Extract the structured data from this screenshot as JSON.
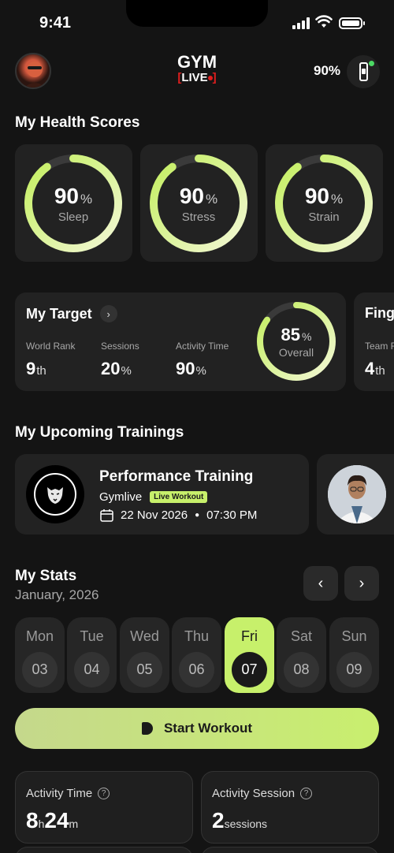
{
  "status_bar": {
    "time": "9:41"
  },
  "header": {
    "logo_line1": "GYM",
    "logo_line2": "LIVE",
    "device_battery": "90%"
  },
  "health": {
    "title": "My Health Scores",
    "scores": [
      {
        "label": "Sleep",
        "value": "90",
        "unit": "%",
        "progress": 0.9
      },
      {
        "label": "Stress",
        "value": "90",
        "unit": "%",
        "progress": 0.9
      },
      {
        "label": "Strain",
        "value": "90",
        "unit": "%",
        "progress": 0.9
      }
    ]
  },
  "target": {
    "title": "My Target",
    "stats": [
      {
        "label": "World Rank",
        "value": "9",
        "suffix": "th"
      },
      {
        "label": "Sessions",
        "value": "20",
        "suffix": "%"
      },
      {
        "label": "Activity Time",
        "value": "90",
        "suffix": "%"
      }
    ],
    "overall": {
      "value": "85",
      "unit": "%",
      "label": "Overall",
      "progress": 0.85
    },
    "next_card": {
      "title": "Fing",
      "label": "Team R",
      "value": "4",
      "suffix": "th"
    }
  },
  "trainings": {
    "title": "My Upcoming Trainings",
    "items": [
      {
        "title": "Performance Training",
        "org": "Gymlive",
        "badge": "Live Workout",
        "date": "22 Nov 2026",
        "time": "07:30 PM"
      }
    ]
  },
  "stats": {
    "title": "My Stats",
    "period": "January, 2026",
    "days": [
      {
        "name": "Mon",
        "num": "03",
        "active": false
      },
      {
        "name": "Tue",
        "num": "04",
        "active": false
      },
      {
        "name": "Wed",
        "num": "05",
        "active": false
      },
      {
        "name": "Thu",
        "num": "06",
        "active": false
      },
      {
        "name": "Fri",
        "num": "07",
        "active": true
      },
      {
        "name": "Sat",
        "num": "08",
        "active": false
      },
      {
        "name": "Sun",
        "num": "09",
        "active": false
      }
    ],
    "start_label": "Start Workout",
    "activity_time": {
      "label": "Activity Time",
      "hours": "8",
      "h_unit": "h",
      "minutes": "24",
      "m_unit": "m"
    },
    "activity_session": {
      "label": "Activity Session",
      "value": "2",
      "unit": "sessions"
    }
  },
  "colors": {
    "accent": "#c7f06b",
    "ring_start": "#f3f7d6",
    "ring_end": "#c3ef5e",
    "card": "#222222",
    "background": "#141414"
  }
}
